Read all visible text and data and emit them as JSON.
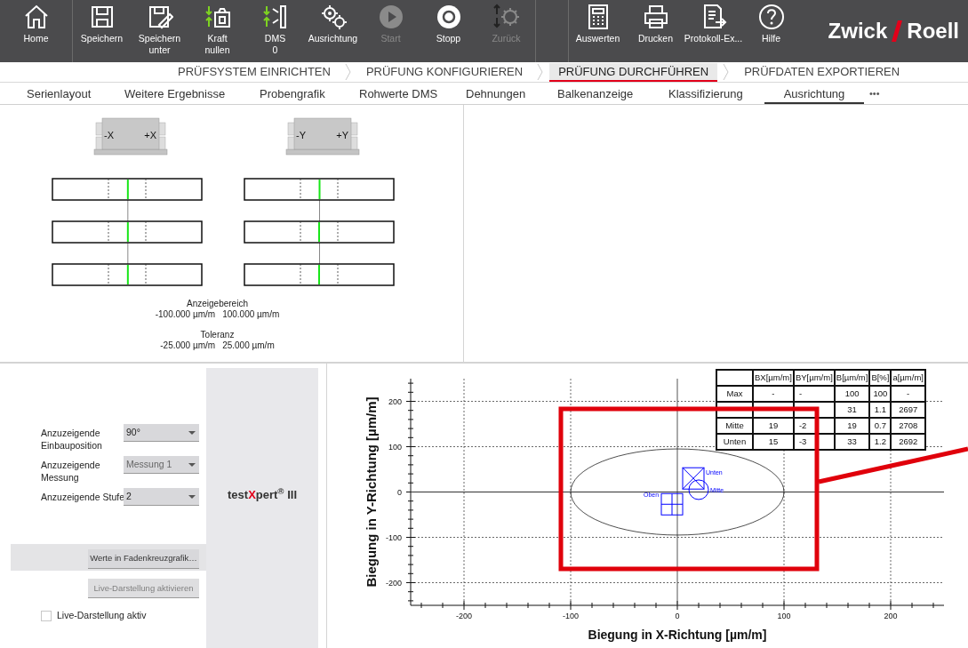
{
  "toolbar": {
    "main_items": [
      {
        "lines": [
          "Home"
        ],
        "disabled": false
      },
      {
        "lines": [
          "Speichern"
        ],
        "disabled": false
      },
      {
        "lines": [
          "Speichern",
          "unter"
        ],
        "disabled": false
      },
      {
        "lines": [
          "Kraft",
          "nullen"
        ],
        "disabled": false
      },
      {
        "lines": [
          "DMS",
          "0"
        ],
        "disabled": false
      },
      {
        "lines": [
          "Ausrichtung"
        ],
        "disabled": false
      },
      {
        "lines": [
          "Start"
        ],
        "disabled": true
      },
      {
        "lines": [
          "Stopp"
        ],
        "disabled": false
      },
      {
        "lines": [
          "Zurück"
        ],
        "disabled": true
      }
    ],
    "report_items": [
      {
        "lines": [
          "Auswerten"
        ],
        "disabled": false
      },
      {
        "lines": [
          "Drucken"
        ],
        "disabled": false
      },
      {
        "lines": [
          "Protokoll-Ex..."
        ],
        "disabled": false
      },
      {
        "lines": [
          "Hilfe"
        ],
        "disabled": false
      }
    ],
    "logo": {
      "left": "Zwick",
      "right": "Roell"
    }
  },
  "workflow_steps": [
    {
      "label": "PRÜFSYSTEM EINRICHTEN",
      "selected": false
    },
    {
      "label": "PRÜFUNG KONFIGURIEREN",
      "selected": false
    },
    {
      "label": "PRÜFUNG DURCHFÜHREN",
      "selected": true
    },
    {
      "label": "PRÜFDATEN EXPORTIEREN",
      "selected": false
    }
  ],
  "tabs": [
    {
      "label": "Serienlayout",
      "selected": false
    },
    {
      "label": "Weitere Ergebnisse",
      "selected": false
    },
    {
      "label": "Probengrafik",
      "selected": false
    },
    {
      "label": "Rohwerte DMS",
      "selected": false
    },
    {
      "label": "Dehnungen",
      "selected": false
    },
    {
      "label": "Balkenanzeige",
      "selected": false
    },
    {
      "label": "Klassifizierung",
      "selected": false
    },
    {
      "label": "Ausrichtung",
      "selected": true
    }
  ],
  "tabs_more": "•••",
  "alignment_panel": {
    "sensors": [
      {
        "labels": [
          "-X",
          "+X"
        ],
        "bars": [
          {
            "level": 0.505
          },
          {
            "level": 0.505
          },
          {
            "level": 0.505
          }
        ]
      },
      {
        "labels": [
          "-Y",
          "+Y"
        ],
        "bars": [
          {
            "level": 0.503
          },
          {
            "level": 0.5
          },
          {
            "level": 0.5
          }
        ]
      }
    ],
    "range": {
      "title": "Anzeigebereich",
      "min": "-100.000 µm/m",
      "max": "100.000 µm/m"
    },
    "tolerance": {
      "title": "Toleranz",
      "min": "-25.000 µm/m",
      "max": "25.000 µm/m"
    }
  },
  "settings": {
    "fields": [
      {
        "label": [
          "Anzuzeigende",
          "Einbauposition"
        ],
        "value": "90°",
        "disabled": false
      },
      {
        "label": [
          "Anzuzeigende",
          "Messung"
        ],
        "value": "Messung 1",
        "disabled": true
      },
      {
        "label": [
          "Anzuzeigende Stufe"
        ],
        "value": "2",
        "disabled": false
      }
    ],
    "buttons": [
      {
        "label": "Werte in Fadenkreuzgrafik…",
        "disabled": false
      },
      {
        "label": "Live-Darstellung aktivieren",
        "disabled": true
      }
    ],
    "checkbox": {
      "label": "Live-Darstellung aktiv",
      "checked": false
    },
    "brand": {
      "before": "test",
      "accent": "X",
      "after": "pert$^{®}$ III"
    }
  },
  "crosshair_chart": {
    "chart_data": {
      "type": "scatter",
      "xlabel": "Biegung in X-Richtung [µm/m]",
      "ylabel": "Biegung in Y-Richtung [µm/m]",
      "xlim": [
        -250,
        250
      ],
      "ylim": [
        -250,
        250
      ],
      "xticks": [
        -200,
        -100,
        0,
        100,
        200
      ],
      "yticks": [
        -200,
        -100,
        0,
        100,
        200
      ],
      "grid": true,
      "series": [
        {
          "name": "Oben",
          "color": "#0000ff",
          "x": [
            -5
          ],
          "values": [
            -27
          ]
        },
        {
          "name": "Unten",
          "color": "#0000ff",
          "x": [
            15
          ],
          "values": [
            30
          ]
        },
        {
          "name": "Mitte",
          "color": "#0000ff",
          "x": [
            20
          ],
          "values": [
            5
          ]
        }
      ]
    },
    "value_table": {
      "columns": [
        "BX[µm/m]",
        "BY[µm/m]",
        "B[µm/m]",
        "B[%]",
        "a[µm/m]"
      ],
      "rows": [
        {
          "label": "Max",
          "cells": [
            "-",
            "-",
            "100",
            "100",
            "-"
          ]
        },
        {
          "label": null,
          "cells": [
            null,
            null,
            "31",
            "1.1",
            "2697"
          ]
        },
        {
          "label": "Mitte",
          "cells": [
            "19",
            "-2",
            "19",
            "0.7",
            "2708"
          ]
        },
        {
          "label": "Unten",
          "cells": [
            "15",
            "-3",
            "33",
            "1.2",
            "2692"
          ]
        }
      ]
    }
  }
}
